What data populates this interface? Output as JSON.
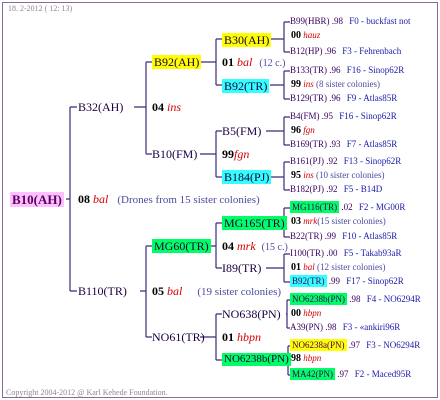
{
  "header": "18. 2-2012 ( 12: 13)",
  "footer": "Copyright 2004-2012 @ Karl Kehede Foundation.",
  "colors": {
    "line": "#3a2a7a",
    "pink": "#ffc0ff",
    "yellow": "#ffff00",
    "cyan": "#33ffff",
    "green": "#00ff66"
  },
  "root": {
    "id": "B10(AH)",
    "num": "08",
    "place": "bal",
    "note": "(Drones from 15 sister colonies)"
  },
  "gen1": [
    {
      "id": "B32(AH)",
      "num": "04",
      "place": "ins"
    },
    {
      "id": "B110(TR)",
      "num": "05",
      "place": "bal",
      "note": "(19 sister colonies)"
    }
  ],
  "gen2": [
    {
      "id": "B92(AH)",
      "num": "01",
      "place": "bal",
      "note": "(12 c.)"
    },
    {
      "id": "B10(FM)",
      "num": "99",
      "place": "fgn"
    },
    {
      "id": "MG60(TR)",
      "num": "04",
      "place": "mrk",
      "note": "(15 c.)"
    },
    {
      "id": "NO61(TR)",
      "num": "01",
      "place": "hbpn"
    }
  ],
  "gen3": [
    {
      "id": "B30(AH)",
      "num": "00",
      "place": "hauz"
    },
    {
      "id": "B92(TR)",
      "num": "99",
      "place": "ins",
      "note": "(8 sister colonies)"
    },
    {
      "id": "B5(FM)",
      "num": "96",
      "place": "fgn"
    },
    {
      "id": "B184(PJ)",
      "num": "95",
      "place": "ins",
      "note": "(10 sister colonies)"
    },
    {
      "id": "MG165(TR)",
      "num": "03",
      "place": "mrk",
      "note": "(15 sister colonies)"
    },
    {
      "id": "I89(TR)",
      "num": "01",
      "place": "bal",
      "note": "(12 sister colonies)"
    },
    {
      "id": "NO638(PN)",
      "num": "00",
      "place": "hbpn"
    },
    {
      "id": "NO6238b(PN)",
      "num": "98",
      "place": "hbpn"
    }
  ],
  "gen4": [
    {
      "id": "B99(HBR)",
      "val": ".98",
      "src": "F0 - buckfast not"
    },
    {
      "id": "B12(HP)",
      "val": ".96",
      "src": "F3 - Fehrenbach"
    },
    {
      "id": "B133(TR)",
      "val": ".96",
      "src": "F16 - Sinop62R"
    },
    {
      "id": "B129(TR)",
      "val": ".96",
      "src": "F9 - Atlas85R"
    },
    {
      "id": "B4(FM)",
      "val": ".95",
      "src": "F16 - Sinop62R"
    },
    {
      "id": "B169(TR)",
      "val": ".93",
      "src": "F7 - Atlas85R"
    },
    {
      "id": "B161(PJ)",
      "val": ".92",
      "src": "F13 - Sinop62R"
    },
    {
      "id": "B182(PJ)",
      "val": ".92",
      "src": "F5 - B14D"
    },
    {
      "id": "MG116(TR)",
      "val": ".02",
      "src": "F2 - MG00R"
    },
    {
      "id": "B22(TR)",
      "val": ".99",
      "src": "F10 - Atlas85R"
    },
    {
      "id": "I100(TR)",
      "val": ".00",
      "src": "F5 - Takab93aR"
    },
    {
      "id": "B92(TR)",
      "val": ".99",
      "src": "F17 - Sinop62R"
    },
    {
      "id": "NO6238b(PN)",
      "val": ".98",
      "src": "F4 - NO6294R"
    },
    {
      "id": "A39(PN)",
      "val": ".98",
      "src": "F3 - «ankiri96R"
    },
    {
      "id": "NO6238a(PN)",
      "val": ".97",
      "src": "F3 - NO6294R"
    },
    {
      "id": "MA42(PN)",
      "val": ".97",
      "src": "F2 - Maced95R"
    }
  ]
}
